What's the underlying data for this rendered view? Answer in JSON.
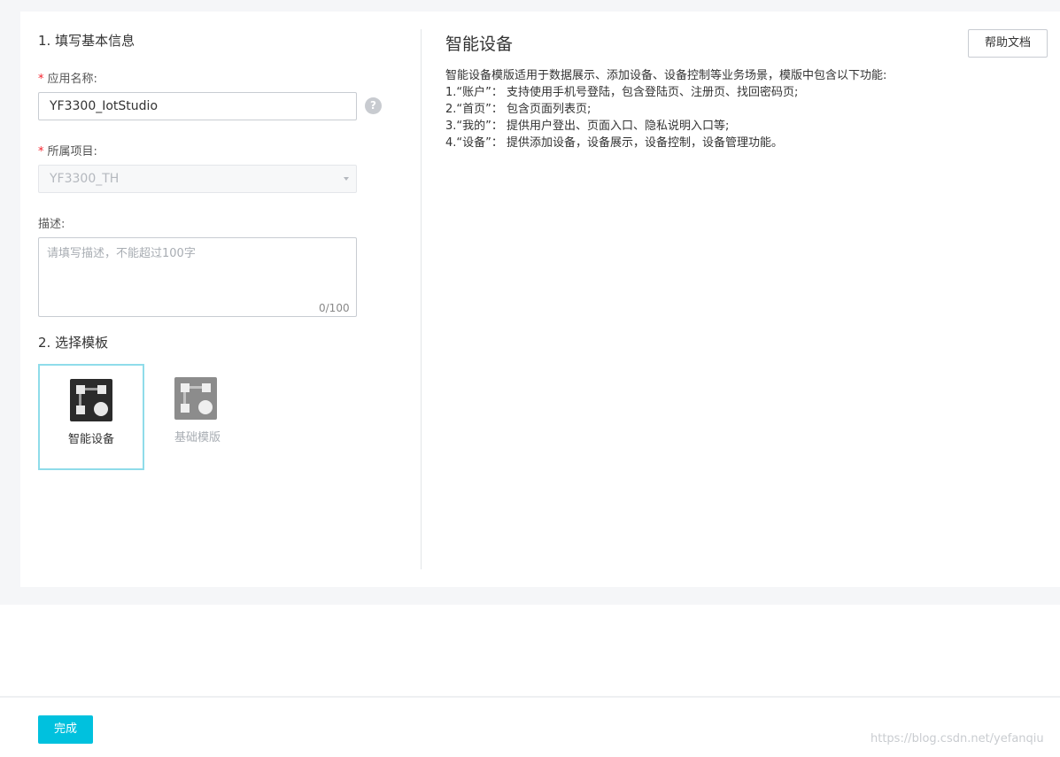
{
  "section1": {
    "title": "1. 填写基本信息",
    "app_name_label": "应用名称:",
    "app_name_value": "YF3300_IotStudio",
    "project_label": "所属项目:",
    "project_value": "YF3300_TH",
    "desc_label": "描述:",
    "desc_placeholder": "请填写描述，不能超过100字",
    "desc_count": "0/100",
    "required_mark": "*",
    "help_icon": "?"
  },
  "section2": {
    "title": "2. 选择模板",
    "templates": [
      {
        "label": "智能设备",
        "selected": true,
        "icon_color": "#2b2b2b"
      },
      {
        "label": "基础模版",
        "selected": false,
        "icon_color": "#8c8c8c"
      }
    ]
  },
  "detail": {
    "title": "智能设备",
    "help_button": "帮助文档",
    "lines": [
      "智能设备模版适用于数据展示、添加设备、设备控制等业务场景，模版中包含以下功能:",
      "1.“账户”： 支持使用手机号登陆，包含登陆页、注册页、找回密码页;",
      "2.“首页”： 包含页面列表页;",
      "3.“我的”： 提供用户登出、页面入口、隐私说明入口等;",
      "4.“设备”：  提供添加设备，设备展示，设备控制，设备管理功能。"
    ]
  },
  "footer": {
    "done_button": "完成",
    "watermark": "https://blog.csdn.net/yefanqiu"
  },
  "colors": {
    "accent": "#00c1de",
    "selected_border": "#8fdcea",
    "required": "#f5222d"
  }
}
